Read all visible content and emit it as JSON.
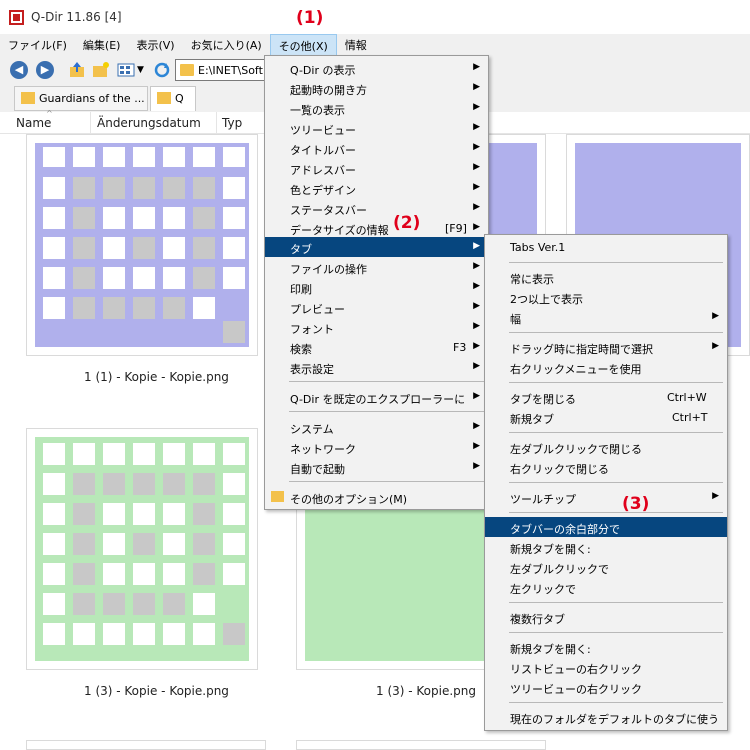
{
  "window": {
    "title": "Q-Dir 11.86 [4]"
  },
  "menubar": [
    "ファイル(F)",
    "編集(E)",
    "表示(V)",
    "お気に入り(A)",
    "その他(X)",
    "情報"
  ],
  "address": {
    "path": "E:\\INET\\Soft"
  },
  "tabs": [
    {
      "label": "Guardians of the ..."
    },
    {
      "label": "Q"
    }
  ],
  "columns": [
    "Name",
    "Änderungsdatum",
    "Typ"
  ],
  "thumbnails": [
    {
      "caption": "1 (1) - Kopie - Kopie.png",
      "color": "#b0b0ec"
    },
    {
      "caption": "1 (3) - Kopie - Kopie.png",
      "color": "#b8e8b8"
    },
    {
      "caption": "1 (3) - Kopie.png",
      "color": "#b8e8b8"
    }
  ],
  "main_menu": {
    "items": [
      {
        "label": "Q-Dir の表示",
        "arrow": "▶"
      },
      {
        "label": "起動時の開き方",
        "arrow": "▶"
      },
      {
        "label": "一覧の表示",
        "arrow": "▶"
      },
      {
        "label": "ツリービュー",
        "arrow": "▶"
      },
      {
        "label": "タイトルバー",
        "arrow": "▶"
      },
      {
        "label": "アドレスバー",
        "arrow": "▶"
      },
      {
        "label": "色とデザイン",
        "arrow": "▶"
      },
      {
        "label": "ステータスバー",
        "arrow": "▶"
      },
      {
        "label": "データサイズの情報",
        "shortcut": "[F9]",
        "arrow": "▶"
      },
      {
        "label": "タブ",
        "arrow": "▶"
      },
      {
        "label": "ファイルの操作",
        "arrow": "▶"
      },
      {
        "label": "印刷",
        "arrow": "▶"
      },
      {
        "label": "プレビュー",
        "arrow": "▶"
      },
      {
        "label": "フォント",
        "arrow": "▶"
      },
      {
        "label": "検索",
        "shortcut": "F3",
        "arrow": "▶"
      },
      {
        "label": "表示設定",
        "arrow": "▶"
      },
      {
        "label": "Q-Dir を既定のエクスプローラーに",
        "arrow": "▶"
      },
      {
        "label": "システム",
        "arrow": "▶"
      },
      {
        "label": "ネットワーク",
        "arrow": "▶"
      },
      {
        "label": "自動で起動",
        "arrow": "▶"
      },
      {
        "label": "その他のオプション(M)"
      }
    ]
  },
  "tab_submenu": {
    "items": [
      {
        "label": "Tabs Ver.1"
      },
      {
        "label": "常に表示"
      },
      {
        "label": "2つ以上で表示"
      },
      {
        "label": "幅",
        "arrow": "▶"
      },
      {
        "label": "ドラッグ時に指定時間で選択",
        "arrow": "▶"
      },
      {
        "label": "右クリックメニューを使用"
      },
      {
        "label": "タブを閉じる",
        "shortcut": "Ctrl+W"
      },
      {
        "label": "新規タブ",
        "shortcut": "Ctrl+T"
      },
      {
        "label": "左ダブルクリックで閉じる"
      },
      {
        "label": "右クリックで閉じる"
      },
      {
        "label": "ツールチップ",
        "arrow": "▶"
      },
      {
        "label": "タブバーの余白部分で"
      },
      {
        "label": "新規タブを開く:"
      },
      {
        "label": "左ダブルクリックで"
      },
      {
        "label": "左クリックで"
      },
      {
        "label": "複数行タブ"
      },
      {
        "label": "新規タブを開く:"
      },
      {
        "label": "リストビューの右クリック"
      },
      {
        "label": "ツリービューの右クリック"
      },
      {
        "label": "現在のフォルダをデフォルトのタブに使う"
      }
    ]
  },
  "annotations": [
    "(1)",
    "(2)",
    "(3)"
  ],
  "colors": {
    "highlight": "#06467f",
    "annotation": "#e0001b"
  }
}
